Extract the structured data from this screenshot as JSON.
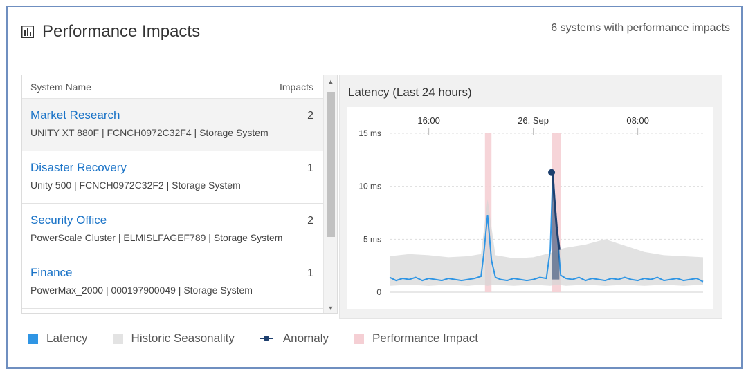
{
  "header": {
    "title": "Performance Impacts",
    "summary": "6 systems with performance impacts"
  },
  "list": {
    "col_name": "System Name",
    "col_impacts": "Impacts",
    "items": [
      {
        "name": "Market Research",
        "details": "UNITY XT 880F | FCNCH0972C32F4 | Storage System",
        "impacts": "2",
        "selected": true
      },
      {
        "name": "Disaster Recovery",
        "details": "Unity 500 | FCNCH0972C32F2 | Storage System",
        "impacts": "1",
        "selected": false
      },
      {
        "name": "Security Office",
        "details": "PowerScale Cluster | ELMISLFAGEF789 | Storage System",
        "impacts": "2",
        "selected": false
      },
      {
        "name": "Finance",
        "details": "PowerMax_2000 | 000197900049 | Storage System",
        "impacts": "1",
        "selected": false
      }
    ]
  },
  "chart": {
    "title": "Latency (Last 24 hours)"
  },
  "legend": {
    "latency": "Latency",
    "seasonality": "Historic Seasonality",
    "anomaly": "Anomaly",
    "impact": "Performance Impact"
  },
  "colors": {
    "latency": "#2f95e4",
    "seasonality": "#dcdcdc",
    "anomaly": "#1d3f6e",
    "impact": "#f5cfd4",
    "link": "#1a73c7"
  },
  "chart_data": {
    "type": "line",
    "title": "Latency (Last 24 hours)",
    "x_ticks": [
      "16:00",
      "26. Sep",
      "08:00"
    ],
    "y_ticks": [
      "0",
      "5 ms",
      "10 ms",
      "15 ms"
    ],
    "ylim": [
      0,
      15
    ],
    "grid": true,
    "legend_position": "bottom",
    "series": [
      {
        "name": "Latency",
        "color": "#2f95e4",
        "x_hours": [
          0,
          0.5,
          1,
          1.5,
          2,
          2.5,
          3,
          3.5,
          4,
          4.5,
          5,
          5.5,
          6,
          6.5,
          7,
          7.2,
          7.5,
          7.8,
          8.1,
          8.5,
          9,
          9.5,
          10,
          10.5,
          11,
          11.5,
          12,
          12.3,
          12.5,
          12.8,
          13.1,
          13.5,
          14,
          14.5,
          15,
          15.5,
          16,
          16.5,
          17,
          17.5,
          18,
          18.5,
          19,
          19.5,
          20,
          20.5,
          21,
          21.5,
          22,
          22.5,
          23,
          23.5,
          24
        ],
        "values": [
          1.4,
          1.1,
          1.3,
          1.2,
          1.4,
          1.1,
          1.3,
          1.2,
          1.1,
          1.3,
          1.2,
          1.1,
          1.2,
          1.3,
          1.5,
          3.5,
          7.3,
          3.0,
          1.4,
          1.2,
          1.1,
          1.3,
          1.2,
          1.1,
          1.2,
          1.4,
          1.3,
          4.0,
          11.3,
          6.0,
          1.6,
          1.3,
          1.2,
          1.4,
          1.1,
          1.3,
          1.2,
          1.1,
          1.3,
          1.2,
          1.4,
          1.2,
          1.1,
          1.3,
          1.2,
          1.4,
          1.1,
          1.2,
          1.3,
          1.1,
          1.2,
          1.3,
          1.0
        ]
      },
      {
        "name": "Historic Seasonality",
        "color": "#dcdcdc",
        "x_hours": [
          0,
          1.5,
          3,
          4.5,
          6,
          7,
          7.5,
          8.1,
          9.5,
          11,
          12.3,
          12.8,
          13.5,
          15,
          16.5,
          18,
          19.5,
          21,
          22.5,
          24
        ],
        "upper": [
          3.4,
          3.6,
          3.5,
          3.3,
          3.4,
          3.6,
          8.8,
          3.5,
          3.2,
          3.3,
          3.7,
          4.0,
          4.2,
          4.5,
          5.0,
          4.4,
          3.8,
          3.5,
          3.4,
          3.3
        ],
        "lower": [
          0.6,
          0.7,
          0.6,
          0.7,
          0.6,
          0.7,
          0.6,
          0.7,
          0.6,
          0.7,
          0.6,
          0.7,
          0.6,
          0.7,
          0.6,
          0.7,
          0.6,
          0.7,
          0.6,
          0.7
        ]
      },
      {
        "name": "Anomaly",
        "color": "#1d3f6e",
        "x_hours": [
          12.4,
          12.5,
          12.6,
          12.8,
          13.0
        ],
        "values": [
          11.3,
          11.0,
          9.0,
          6.0,
          4.0
        ]
      }
    ],
    "impact_windows": [
      [
        7.3,
        7.8
      ],
      [
        12.4,
        13.1
      ]
    ]
  }
}
